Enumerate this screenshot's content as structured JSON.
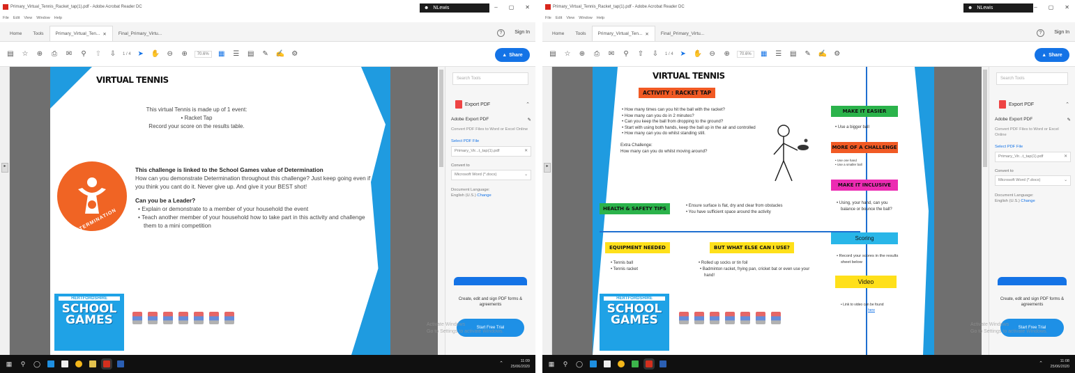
{
  "window_title": "Primary_Virtual_Tennis_Racket_tap(1).pdf - Adobe Acrobat Reader DC",
  "window_title_right": "Primary_Virtual_Tennis_Racket_tap(1).pdf - Adobe Acrobat Reader DC",
  "user_label": "NLewis",
  "window_controls": [
    "–",
    "▢",
    "✕"
  ],
  "menu": [
    "File",
    "Edit",
    "View",
    "Window",
    "Help"
  ],
  "tabs": [
    {
      "label": "Home"
    },
    {
      "label": "Tools"
    },
    {
      "label": "Primary_Virtual_Ten...",
      "close": "✕"
    },
    {
      "label": "Final_Primary_Virtu..."
    }
  ],
  "help_icon": "?",
  "sign_in": "Sign In",
  "share_label": "Share",
  "page_indicator": "1 / 4",
  "zoom_level": "70.6%",
  "right_pane": {
    "search_placeholder": "Search Tools",
    "export_title": "Export PDF",
    "adobe_export_title": "Adobe Export PDF",
    "adobe_export_desc": "Convert PDF Files to Word or Excel Online",
    "select_file_label": "Select PDF File",
    "selected_file": "Primary_Vir...t_tap(1).pdf",
    "convert_to_label": "Convert to",
    "convert_to_value": "Microsoft Word (*.docx)",
    "doc_lang_label": "Document Language:",
    "doc_lang_value": "English (U.S.)",
    "doc_lang_change": "Change",
    "promo_text": "Create, edit and sign PDF forms & agreements",
    "trial_button": "Start Free Trial",
    "watermark_line1": "Activate Windows",
    "watermark_line2": "Go to Settings to activate Windows."
  },
  "page1": {
    "title": "VIRTUAL TENNIS",
    "intro_line1": "This virtual Tennis is made up of 1 event:",
    "intro_bullet": "Racket Tap",
    "intro_line3": "Record your score on the results table.",
    "badge_text": "DETERMINATION",
    "value_heading": "This challenge is linked to the School Games value of Determination",
    "value_body": "How can you demonstrate Determination throughout this challenge? Just keep going even if you think you cant do it. Never give up. And give it your BEST shot!",
    "leader_heading": "Can you be a Leader?",
    "leader_bullets": [
      "Explain or demonstrate to a member of your household the event",
      "Teach another member of your household how to take part in this activity and challenge them to a mini competition"
    ]
  },
  "page2": {
    "title": "VIRTUAL TENNIS",
    "activity_label": "ACTIVITY : RACKET TAP",
    "activity_bullets": [
      "How many times can you hit the ball with the racket?",
      "How many can you do in 2 minutes?",
      "Can you keep the ball from dropping to the ground?",
      "Start with using both hands, keep the ball up in the air and controlled",
      "How many can you do whilst standing still."
    ],
    "extra_challenge_1": "Extra Challenge:",
    "extra_challenge_2": "How many can you do whilst moving around?",
    "safety_label": "HEALTH & SAFETY TIPS",
    "safety_bullets": [
      "Ensure surface is flat, dry and clear from obstacles",
      "You have sufficient space around the activity"
    ],
    "equipment_label": "EQUIPMENT NEEDED",
    "equipment_items": [
      "Tennis ball",
      "Tennis racket"
    ],
    "what_else_label": "BUT WHAT ELSE CAN I USE?",
    "what_else_items": [
      "Rolled up socks or tin foil",
      "Badminton racket, frying pan, cricket bat or even use your hand!"
    ],
    "easier_label": "MAKE IT EASIER",
    "easier_items": [
      "Use a bigger ball"
    ],
    "challenge_label": "MORE OF A CHALLENGE",
    "challenge_items": [
      "Use one hand",
      "Use a smaller ball"
    ],
    "inclusive_label": "MAKE IT INCLUSIVE",
    "inclusive_items": [
      "Using, your hand, can you balance or bounce the ball?"
    ],
    "scoring_label": "Scoring",
    "scoring_items": [
      "Record your scores in the results sheet below"
    ],
    "video_label": "Video",
    "video_items": [
      "Link to video can be found"
    ],
    "video_link": "here"
  },
  "logo": {
    "county": "HERTFORDSHIRE",
    "school": "SCHOOL",
    "games": "GAMES"
  },
  "taskbar": {
    "time": "11:09",
    "date": "25/06/2020",
    "time_right": "11:08",
    "date_right": "25/06/2020"
  },
  "colors": {
    "accent_blue": "#1f9be0",
    "orange": "#f15a24",
    "green": "#2bb34b",
    "magenta": "#ec2bb2",
    "yellow": "#ffe01a",
    "cyan": "#29b6e8"
  }
}
